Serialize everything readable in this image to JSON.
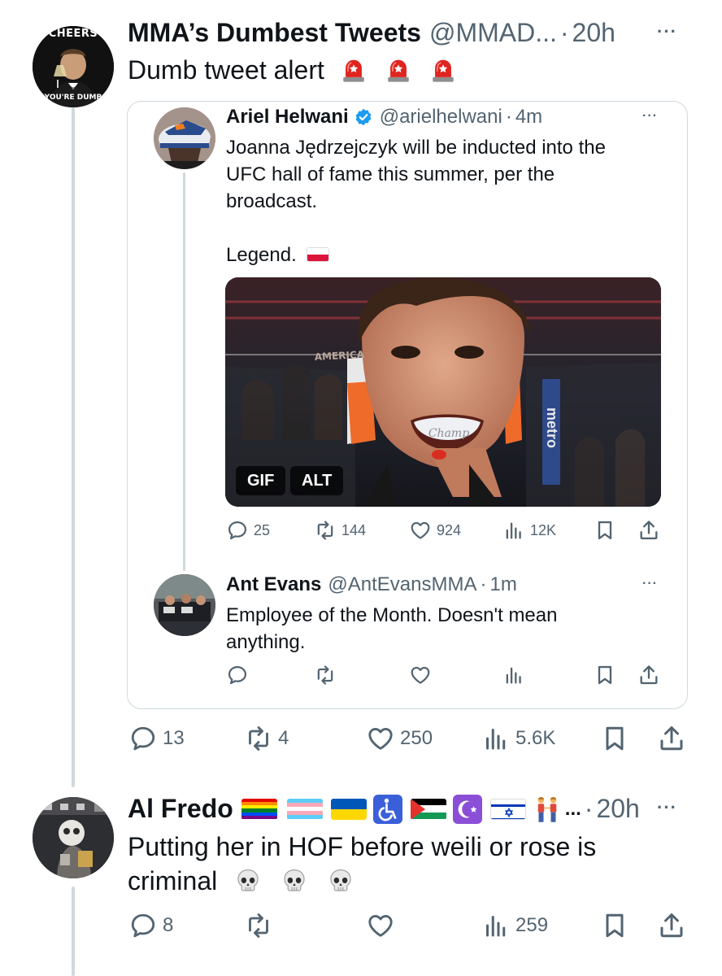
{
  "main_post": {
    "display_name": "MMA’s Dumbest Tweets",
    "handle": "@MMAD...",
    "time": "20h",
    "text": "Dumb tweet alert",
    "text_emojis": [
      "siren-icon",
      "siren-icon",
      "siren-icon"
    ],
    "avatar_top_text": "CHEERS",
    "avatar_bottom_text": "YOU'RE DUMB",
    "stats": {
      "replies": "13",
      "reposts": "4",
      "likes": "250",
      "views": "5.6K"
    }
  },
  "quoted_post": {
    "display_name": "Ariel Helwani",
    "verified": true,
    "handle": "@arielhelwani",
    "time": "4m",
    "text_line1": "Joanna Jędrzejczyk will be inducted into the",
    "text_line2": "UFC hall of fame this summer, per the",
    "text_line3": "broadcast.",
    "text_line4": "Legend.",
    "flag": "poland-flag-icon",
    "media_tags": {
      "gif": "GIF",
      "alt": "ALT"
    },
    "media_sign_left": "AMERICA",
    "media_sign_right": "metro",
    "mouthguard_text": "Champ",
    "stats": {
      "replies": "25",
      "reposts": "144",
      "likes": "924",
      "views": "12K"
    }
  },
  "quoted_reply": {
    "display_name": "Ant Evans",
    "handle": "@AntEvansMMA",
    "time": "1m",
    "text_line1": "Employee of the Month. Doesn't mean",
    "text_line2": "anything."
  },
  "reply_post": {
    "display_name": "Al Fredo",
    "name_emojis": [
      "rainbow-flag-icon",
      "transgender-flag-icon",
      "ukraine-flag-icon",
      "wheelchair-icon",
      "palestine-flag-icon",
      "star-and-crescent-icon",
      "israel-flag-icon",
      "two-men-holding-hands-icon"
    ],
    "ellipsis": "...",
    "time": "20h",
    "text_line1": "Putting her in HOF before weili or rose is",
    "text_line2": "criminal",
    "text_emojis": [
      "skull-icon",
      "skull-icon",
      "skull-icon"
    ],
    "stats": {
      "replies": "8",
      "views": "259"
    }
  },
  "separators": {
    "dot": "·",
    "more": "···"
  }
}
